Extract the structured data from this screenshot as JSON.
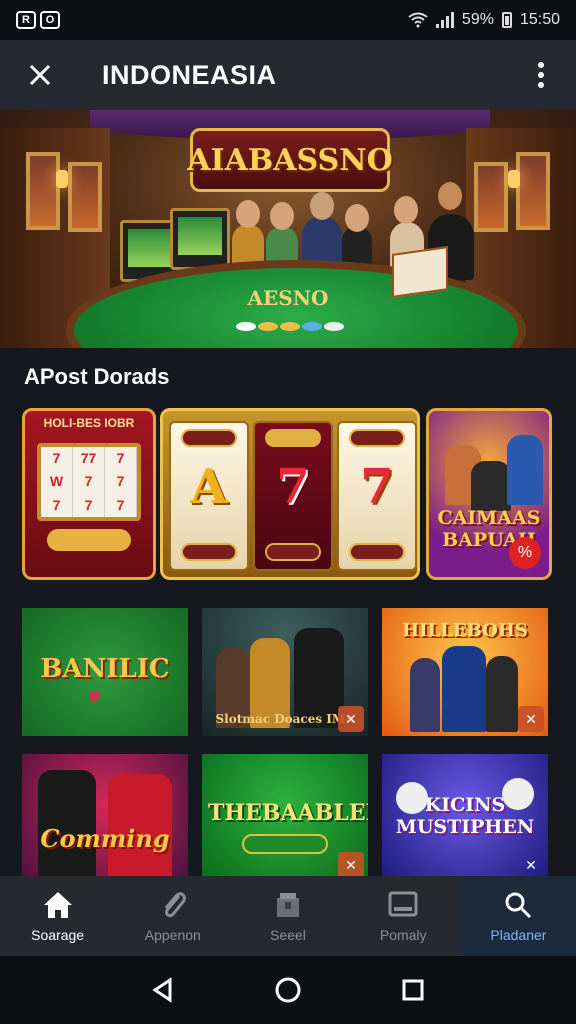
{
  "status_bar": {
    "left_icons": [
      "R",
      "O"
    ],
    "battery_text": "59%",
    "time": "15:50",
    "icons": [
      "wifi-icon",
      "signal-icon",
      "battery-icon"
    ]
  },
  "app_bar": {
    "title": "INDONEASIA",
    "close_icon": "close-icon",
    "menu_icon": "more-vertical-icon"
  },
  "hero": {
    "logo_text": "AIABASSNO",
    "table_text": "AESNO"
  },
  "section": {
    "title": "APost Dorads"
  },
  "featured": [
    {
      "caption": "HOLI-BES IOBR",
      "reel_symbols": [
        "7",
        "77",
        "7",
        "W",
        "7",
        "7",
        "7",
        "7",
        "7"
      ],
      "button_icon": "play-button"
    },
    {
      "symbols": [
        "A",
        "7",
        "7"
      ],
      "reel_tags": [
        "",
        "",
        ""
      ]
    },
    {
      "title": "CAIMAAS BAPUAH",
      "badge_icon": "percent-icon"
    }
  ],
  "tiles": [
    {
      "title": "BANILIC"
    },
    {
      "title": "Slotmac Doaces IMA"
    },
    {
      "title": "HILLEBOHS"
    },
    {
      "title": "Comming"
    },
    {
      "title": "THEBAABLEK"
    },
    {
      "title": "KICINS MUSTIPHEN"
    }
  ],
  "bottom_nav": [
    {
      "label": "Soarage",
      "icon": "home-icon",
      "state": "active"
    },
    {
      "label": "Appenon",
      "icon": "paperclip-icon",
      "state": "normal"
    },
    {
      "label": "Seeel",
      "icon": "package-icon",
      "state": "normal"
    },
    {
      "label": "Pomaly",
      "icon": "computer-icon",
      "state": "normal"
    },
    {
      "label": "Pladaner",
      "icon": "search-icon",
      "state": "selected"
    }
  ],
  "system_nav": [
    "back-icon",
    "home-circle-icon",
    "recents-icon"
  ],
  "colors": {
    "app_bar_bg": "#262a30",
    "page_bg": "#15181f",
    "nav_selected": "#7fb2ff"
  }
}
